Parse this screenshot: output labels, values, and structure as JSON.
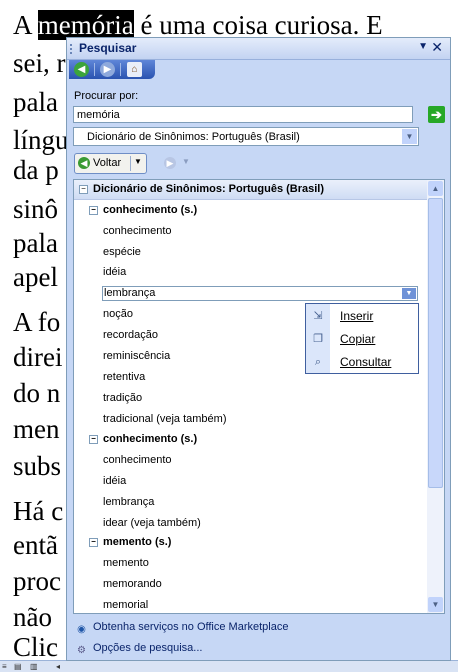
{
  "document": {
    "lines": [
      {
        "before": "A ",
        "highlight": "memória",
        "after": " é uma coisa curiosa. E"
      },
      {
        "before": "sei, r",
        "highlight": "",
        "after": ""
      },
      {
        "before": "pala",
        "highlight": "",
        "after": ""
      },
      {
        "before": "língu",
        "highlight": "",
        "after": ""
      },
      {
        "before": "da p",
        "highlight": "",
        "after": ""
      },
      {
        "before": "sinô",
        "highlight": "",
        "after": ""
      },
      {
        "before": "pala",
        "highlight": "",
        "after": ""
      },
      {
        "before": "apel",
        "highlight": "",
        "after": ""
      },
      {
        "before": "A fo",
        "highlight": "",
        "after": ""
      },
      {
        "before": "direi",
        "highlight": "",
        "after": ""
      },
      {
        "before": "do n",
        "highlight": "",
        "after": ""
      },
      {
        "before": "men",
        "highlight": "",
        "after": ""
      },
      {
        "before": "subs",
        "highlight": "",
        "after": ""
      },
      {
        "before": "Há c",
        "highlight": "",
        "after": ""
      },
      {
        "before": "entã",
        "highlight": "",
        "after": ""
      },
      {
        "before": "proc",
        "highlight": "",
        "after": ""
      },
      {
        "before": "não",
        "highlight": "",
        "after": ""
      },
      {
        "before": "Clic",
        "highlight": "",
        "after": ""
      }
    ]
  },
  "pane": {
    "title": "Pesquisar",
    "search_label": "Procurar por:",
    "search_value": "memória",
    "source": "Dicionário de Sinônimos: Português (Brasil)",
    "back_label": "Voltar",
    "results_header": "Dicionário de Sinônimos: Português (Brasil)",
    "groups": [
      {
        "heading": "conhecimento (s.)",
        "items": [
          "conhecimento",
          "espécie",
          "idéia",
          "lembrança",
          "noção",
          "recordação",
          "reminiscência",
          "retentiva",
          "tradição",
          "tradicional (veja também)"
        ]
      },
      {
        "heading": "conhecimento (s.)",
        "items": [
          "conhecimento",
          "idéia",
          "lembrança",
          "idear (veja também)"
        ]
      },
      {
        "heading": "memento (s.)",
        "items": [
          "memento",
          "memorando",
          "memorial"
        ]
      }
    ],
    "context_menu": [
      "Inserir",
      "Copiar",
      "Consultar"
    ],
    "footer_links": [
      "Obtenha serviços no Office Marketplace",
      "Opções de pesquisa..."
    ]
  },
  "colors": {
    "accent": "#2a53b0",
    "pane_bg": "#c6d7f5",
    "go": "#27a827"
  }
}
